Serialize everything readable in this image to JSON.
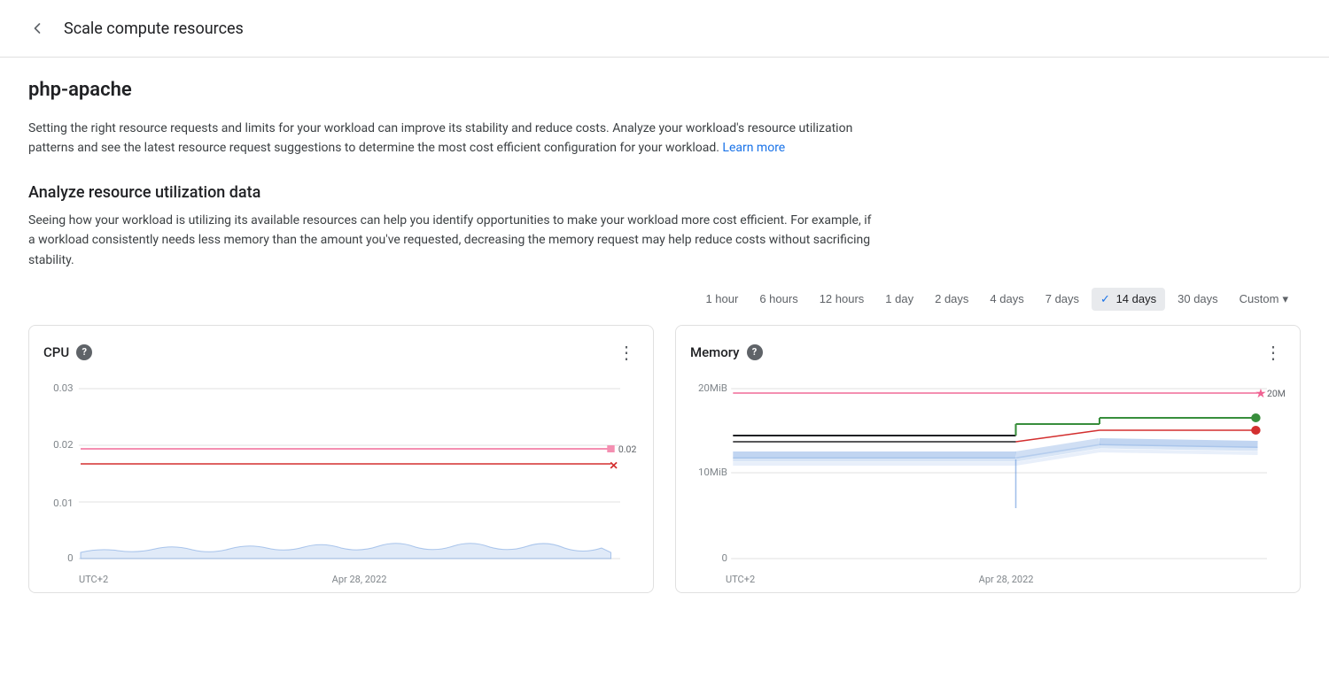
{
  "header": {
    "title": "Scale compute resources",
    "back_label": "back"
  },
  "workload": {
    "name": "php-apache"
  },
  "description": {
    "text": "Setting the right resource requests and limits for your workload can improve its stability and reduce costs. Analyze your workload's resource utilization patterns and see the latest resource request suggestions to determine the most cost efficient configuration for your workload.",
    "learn_more": "Learn more"
  },
  "analyze_section": {
    "title": "Analyze resource utilization data",
    "desc": "Seeing how your workload is utilizing its available resources can help you identify opportunities to make your workload more cost efficient. For example, if a workload consistently needs less memory than the amount you've requested, decreasing the memory request may help reduce costs without sacrificing stability."
  },
  "time_selector": {
    "options": [
      "1 hour",
      "6 hours",
      "12 hours",
      "1 day",
      "2 days",
      "4 days",
      "7 days",
      "14 days",
      "30 days"
    ],
    "active": "14 days",
    "custom": "Custom"
  },
  "charts": {
    "cpu": {
      "title": "CPU",
      "help": "?",
      "more": "⋮",
      "y_labels": [
        "0.03",
        "0.02",
        "0.01",
        "0"
      ],
      "footer_left": "UTC+2",
      "footer_right": "Apr 28, 2022"
    },
    "memory": {
      "title": "Memory",
      "help": "?",
      "more": "⋮",
      "y_labels": [
        "20MiB",
        "10MiB",
        "0"
      ],
      "footer_left": "UTC+2",
      "footer_right": "Apr 28, 2022"
    }
  }
}
